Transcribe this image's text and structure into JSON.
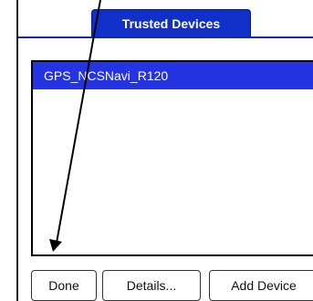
{
  "tab": {
    "label": "Trusted Devices"
  },
  "devices": {
    "items": [
      "GPS_NCSNavi_R120"
    ],
    "selected_index": 0
  },
  "buttons": {
    "done_label": "Done",
    "details_label": "Details...",
    "add_device_label": "Add Device"
  },
  "annotation": {
    "arrow_color": "#000000"
  },
  "colors": {
    "tab_background": "#1030c8",
    "selection_background": "#2434e0",
    "rule": "#1428b4"
  }
}
